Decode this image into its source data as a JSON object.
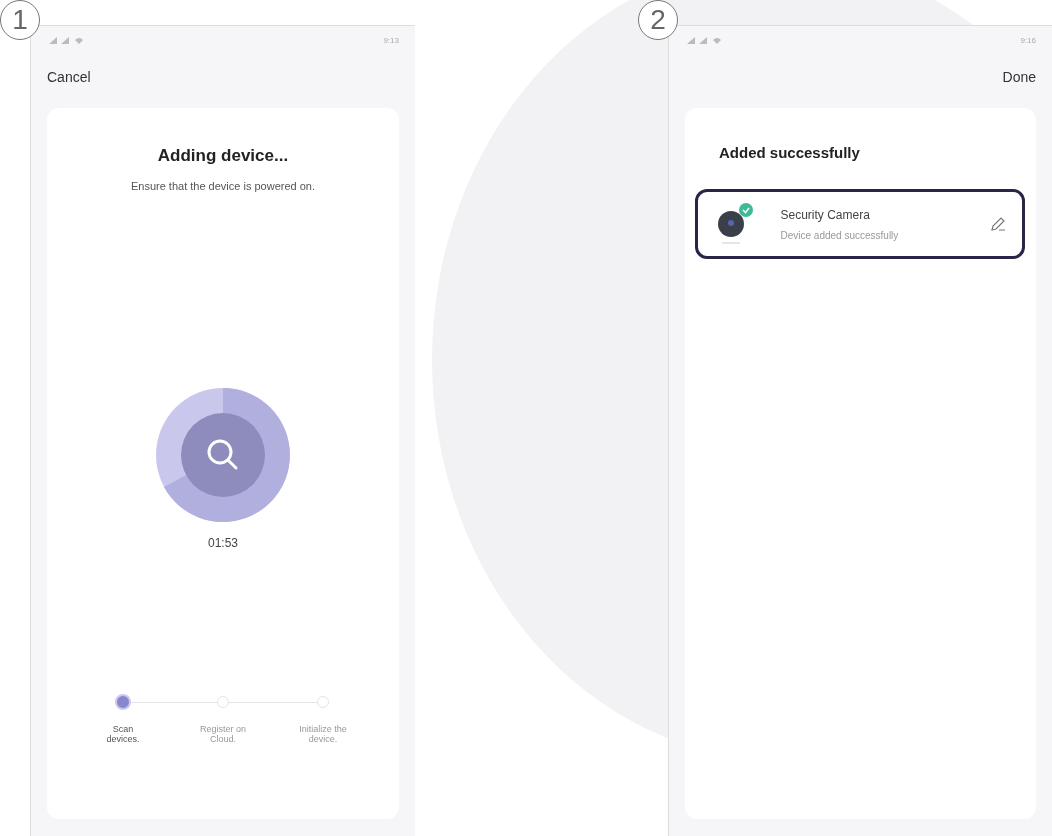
{
  "screens": [
    {
      "number": "1",
      "status_bar": {
        "time": "9:13"
      },
      "nav": {
        "left": "Cancel"
      },
      "title": "Adding device...",
      "subtitle": "Ensure that the device is powered on.",
      "timer": "01:53",
      "steps": [
        {
          "label": "Scan devices.",
          "selected": true
        },
        {
          "label": "Register on Cloud.",
          "selected": false
        },
        {
          "label": "Initialize the device.",
          "selected": false
        }
      ]
    },
    {
      "number": "2",
      "status_bar": {
        "time": "9:16"
      },
      "nav": {
        "right": "Done"
      },
      "title": "Added successfully",
      "devices": [
        {
          "name": "Security Camera",
          "status": "Device added successfully",
          "highlighted": true
        }
      ]
    }
  ]
}
